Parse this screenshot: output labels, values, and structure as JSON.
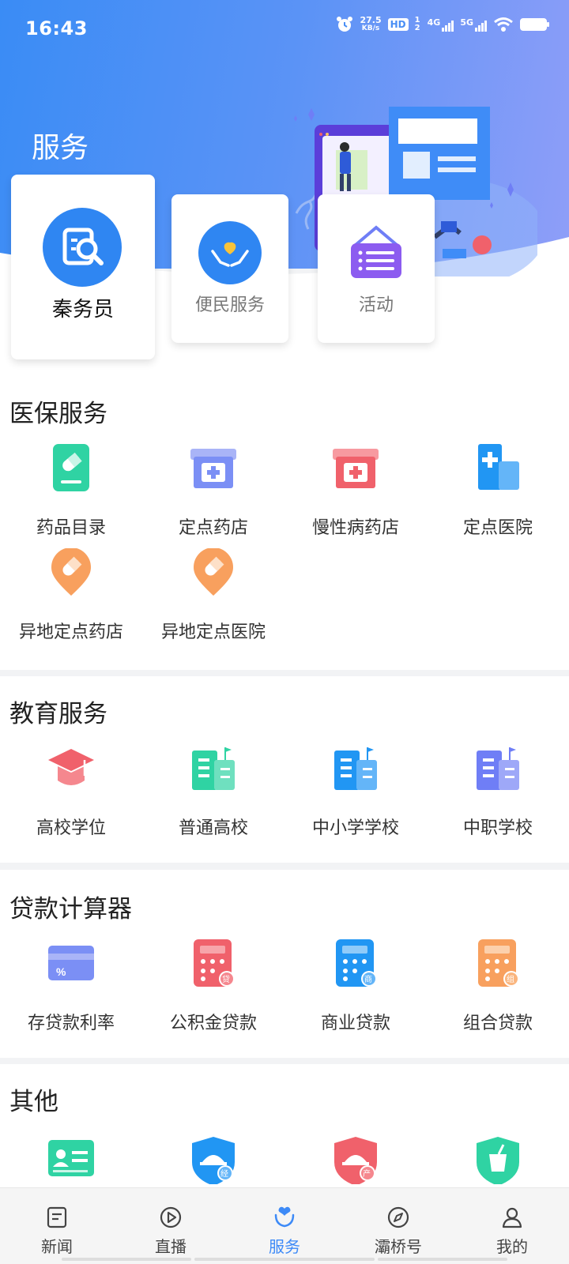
{
  "status": {
    "time": "16:43",
    "speed_top": "27.5",
    "speed_bottom": "KB/s",
    "hd": "HD",
    "sim": "1 2",
    "net1": "4G",
    "net2": "5G"
  },
  "header": {
    "title": "服务"
  },
  "top_cards": [
    {
      "label": "秦务员"
    },
    {
      "label": "便民服务"
    },
    {
      "label": "活动"
    }
  ],
  "sections": {
    "medical": {
      "title": "医保服务",
      "items": [
        {
          "label": "药品目录",
          "icon": "medicine-catalog-icon"
        },
        {
          "label": "定点药店",
          "icon": "pharmacy-icon"
        },
        {
          "label": "慢性病药店",
          "icon": "chronic-pharmacy-icon"
        },
        {
          "label": "定点医院",
          "icon": "hospital-icon"
        },
        {
          "label": "异地定点药店",
          "icon": "remote-pharmacy-icon"
        },
        {
          "label": "异地定点医院",
          "icon": "remote-hospital-icon"
        }
      ]
    },
    "education": {
      "title": "教育服务",
      "items": [
        {
          "label": "高校学位",
          "icon": "graduation-cap-icon"
        },
        {
          "label": "普通高校",
          "icon": "university-building-icon"
        },
        {
          "label": "中小学学校",
          "icon": "school-building-icon"
        },
        {
          "label": "中职学校",
          "icon": "vocational-school-icon"
        }
      ]
    },
    "loan": {
      "title": "贷款计算器",
      "items": [
        {
          "label": "存贷款利率",
          "icon": "interest-rate-card-icon"
        },
        {
          "label": "公积金贷款",
          "icon": "fund-loan-calculator-icon"
        },
        {
          "label": "商业贷款",
          "icon": "commercial-loan-calculator-icon"
        },
        {
          "label": "组合贷款",
          "icon": "combined-loan-calculator-icon"
        }
      ]
    },
    "other": {
      "title": "其他",
      "items": [
        {
          "icon": "id-card-icon"
        },
        {
          "icon": "food-business-shield-icon"
        },
        {
          "icon": "food-production-shield-icon"
        },
        {
          "icon": "food-safety-shield-icon"
        }
      ]
    }
  },
  "badges": {
    "fund": "贷",
    "commercial": "商",
    "combined": "组",
    "business": "经",
    "production": "产",
    "percent": "%"
  },
  "tabbar": {
    "items": [
      {
        "label": "新闻",
        "icon": "news-icon"
      },
      {
        "label": "直播",
        "icon": "live-play-icon"
      },
      {
        "label": "服务",
        "icon": "service-heart-icon",
        "active": true
      },
      {
        "label": "灞桥号",
        "icon": "compass-icon"
      },
      {
        "label": "我的",
        "icon": "profile-icon"
      }
    ]
  },
  "colors": {
    "accent": "#3d8af7",
    "green": "#2fd3a3",
    "blue": "#2196f3",
    "red": "#f0616b",
    "orange": "#f8a05e",
    "indigo": "#7b8ff5"
  }
}
